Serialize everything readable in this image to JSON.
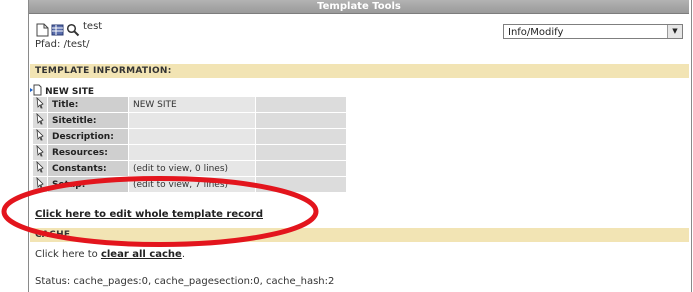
{
  "window": {
    "title": "Template Tools"
  },
  "toolbar": {
    "search_text": "test",
    "path_text": "Pfad: /test/"
  },
  "mode_select": {
    "value": "Info/Modify"
  },
  "template_info": {
    "header": "TEMPLATE INFORMATION:",
    "site_name": "NEW SITE",
    "rows": [
      {
        "label": "Title:",
        "value": "NEW SITE"
      },
      {
        "label": "Sitetitle:",
        "value": ""
      },
      {
        "label": "Description:",
        "value": ""
      },
      {
        "label": "Resources:",
        "value": ""
      },
      {
        "label": "Constants:",
        "value": "(edit to view, 0 lines)"
      },
      {
        "label": "Setup:",
        "value": "(edit to view, 7 lines)"
      }
    ]
  },
  "edit_link": "Click here to edit whole template record",
  "cache": {
    "header": "CACHE",
    "prefix": "Click here to ",
    "link": "clear all cache",
    "suffix": ".",
    "status": "Status: cache_pages:0, cache_pagesection:0, cache_hash:2"
  },
  "colors": {
    "section_bg": "#f2e4b4",
    "highlight_oval": "#e3151d"
  }
}
